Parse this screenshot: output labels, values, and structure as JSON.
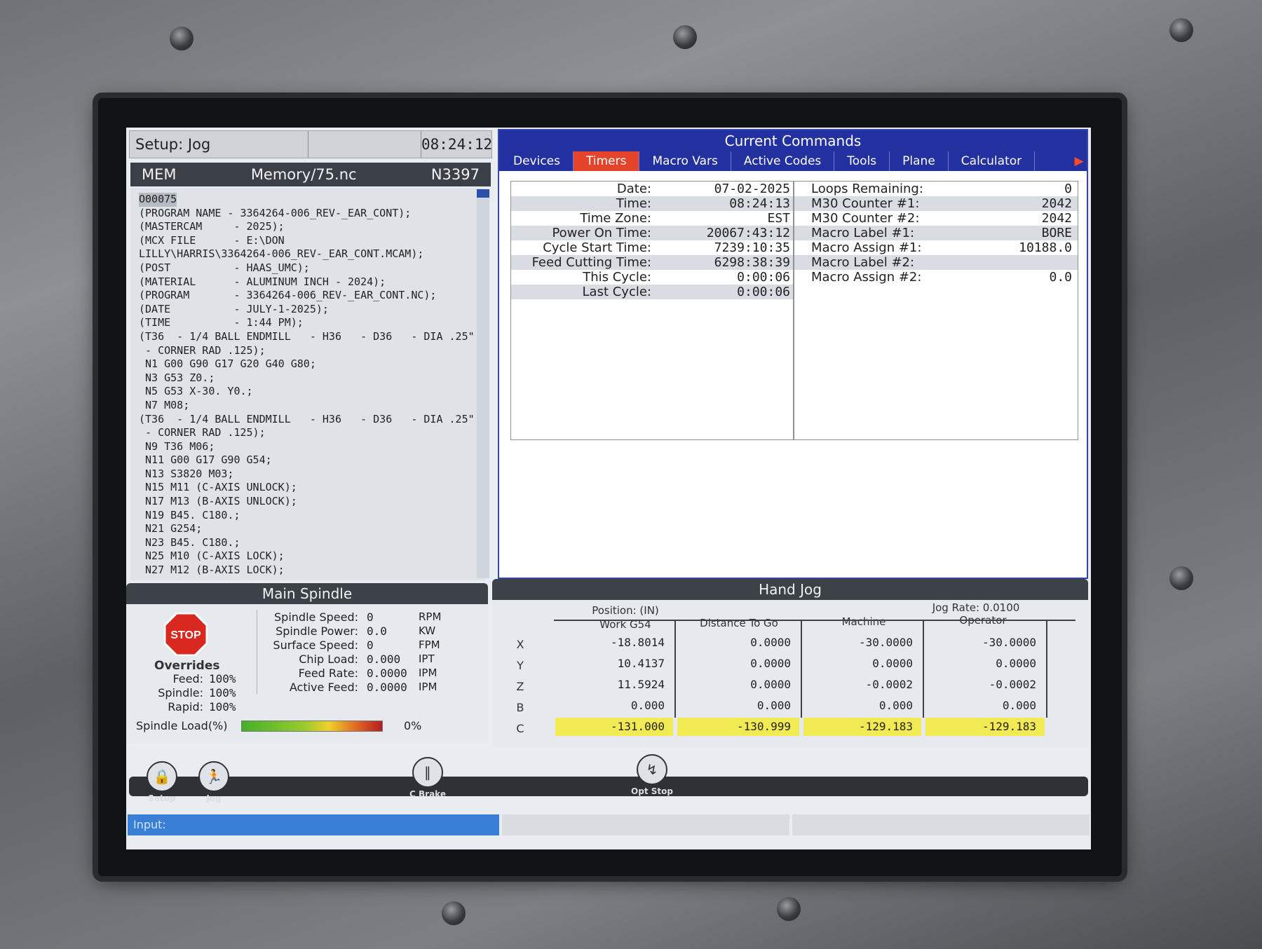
{
  "status": {
    "mode": "Setup: Jog",
    "clock": "08:24:12"
  },
  "program": {
    "mode": "MEM",
    "file": "Memory/75.nc",
    "block": "N3397"
  },
  "code_lines": [
    "O00075",
    "(PROGRAM NAME - 3364264-006_REV-_EAR_CONT);",
    "(MASTERCAM     - 2025);",
    "(MCX FILE      - E:\\DON",
    "LILLY\\HARRIS\\3364264-006_REV-_EAR_CONT.MCAM);",
    "(POST          - HAAS_UMC);",
    "(MATERIAL      - ALUMINUM INCH - 2024);",
    "(PROGRAM       - 3364264-006_REV-_EAR_CONT.NC);",
    "(DATE          - JULY-1-2025);",
    "(TIME          - 1:44 PM);",
    "(T36  - 1/4 BALL ENDMILL   - H36   - D36   - DIA .25\"",
    " - CORNER RAD .125);",
    " N1 G00 G90 G17 G20 G40 G80;",
    " N3 G53 Z0.;",
    " N5 G53 X-30. Y0.;",
    " N7 M08;",
    "(T36  - 1/4 BALL ENDMILL   - H36   - D36   - DIA .25\"",
    " - CORNER RAD .125);",
    " N9 T36 M06;",
    " N11 G00 G17 G90 G54;",
    " N13 S3820 M03;",
    " N15 M11 (C-AXIS UNLOCK);",
    " N17 M13 (B-AXIS UNLOCK);",
    " N19 B45. C180.;",
    " N21 G254;",
    " N23 B45. C180.;",
    " N25 M10 (C-AXIS LOCK);",
    " N27 M12 (B-AXIS LOCK);"
  ],
  "current_commands": {
    "title": "Current Commands",
    "tabs": [
      "Devices",
      "Timers",
      "Macro Vars",
      "Active Codes",
      "Tools",
      "Plane",
      "Calculator"
    ],
    "active_tab": "Timers",
    "timers": [
      {
        "k": "Date:",
        "v": "07-02-2025"
      },
      {
        "k": "Time:",
        "v": "08:24:13"
      },
      {
        "k": "Time Zone:",
        "v": "EST"
      },
      {
        "k": "Power On Time:",
        "v": "20067:43:12"
      },
      {
        "k": "Cycle Start Time:",
        "v": "7239:10:35"
      },
      {
        "k": "Feed Cutting Time:",
        "v": "6298:38:39"
      },
      {
        "k": "This Cycle:",
        "v": "0:00:06"
      },
      {
        "k": "Last Cycle:",
        "v": "0:00:06"
      }
    ],
    "macros": [
      {
        "k": "Loops Remaining:",
        "v": "0"
      },
      {
        "k": "M30 Counter #1:",
        "v": "2042"
      },
      {
        "k": "M30 Counter #2:",
        "v": "2042"
      },
      {
        "k": "Macro Label #1:",
        "v": "BORE"
      },
      {
        "k": "Macro Assign #1:",
        "v": "10188.0"
      },
      {
        "k": "Macro Label #2:",
        "v": ""
      },
      {
        "k": "Macro Assign #2:",
        "v": "0.0"
      }
    ]
  },
  "spindle": {
    "title": "Main Spindle",
    "stop_label": "STOP",
    "overrides_title": "Overrides",
    "overrides": [
      {
        "k": "Feed:",
        "v": "100%"
      },
      {
        "k": "Spindle:",
        "v": "100%"
      },
      {
        "k": "Rapid:",
        "v": "100%"
      }
    ],
    "params": [
      {
        "k": "Spindle Speed:",
        "v": "0",
        "u": "RPM"
      },
      {
        "k": "Spindle Power:",
        "v": "0.0",
        "u": "KW"
      },
      {
        "k": "Surface Speed:",
        "v": "0",
        "u": "FPM"
      },
      {
        "k": "Chip Load:",
        "v": "0.000",
        "u": "IPT"
      },
      {
        "k": "Feed Rate:",
        "v": "0.0000",
        "u": "IPM"
      },
      {
        "k": "Active Feed:",
        "v": "0.0000",
        "u": "IPM"
      }
    ],
    "load_label": "Spindle Load(%)",
    "load_pct": "0%",
    "load_value": 0
  },
  "hand_jog": {
    "title": "Hand Jog",
    "jog_rate": "Jog Rate: 0.0100",
    "col_position": "Position: (IN)",
    "col_work": "Work G54",
    "col_dtg": "Distance To Go",
    "col_machine": "Machine",
    "col_operator": "Operator",
    "rows": [
      {
        "axis": "X",
        "work": "-18.8014",
        "dtg": "0.0000",
        "machine": "-30.0000",
        "operator": "-30.0000"
      },
      {
        "axis": "Y",
        "work": "10.4137",
        "dtg": "0.0000",
        "machine": "0.0000",
        "operator": "0.0000"
      },
      {
        "axis": "Z",
        "work": "11.5924",
        "dtg": "0.0000",
        "machine": "-0.0002",
        "operator": "-0.0002"
      },
      {
        "axis": "B",
        "work": "0.000",
        "dtg": "0.000",
        "machine": "0.000",
        "operator": "0.000"
      },
      {
        "axis": "C",
        "work": "-131.000",
        "dtg": "-130.999",
        "machine": "-129.183",
        "operator": "-129.183"
      }
    ]
  },
  "bottom": {
    "setup": "Setup",
    "jog": "Jog",
    "cbrake": "C Brake",
    "optstop": "Opt Stop",
    "input_label": "Input:"
  },
  "colors": {
    "accent": "#2330a0",
    "active_tab": "#e4452a",
    "highlight": "#f2ea52",
    "input": "#3a7fd6"
  },
  "icons": [
    "lock-icon",
    "jog-walk-icon",
    "c-brake-icon",
    "opt-stop-icon",
    "stop-sign-icon",
    "right-arrow-icon"
  ]
}
